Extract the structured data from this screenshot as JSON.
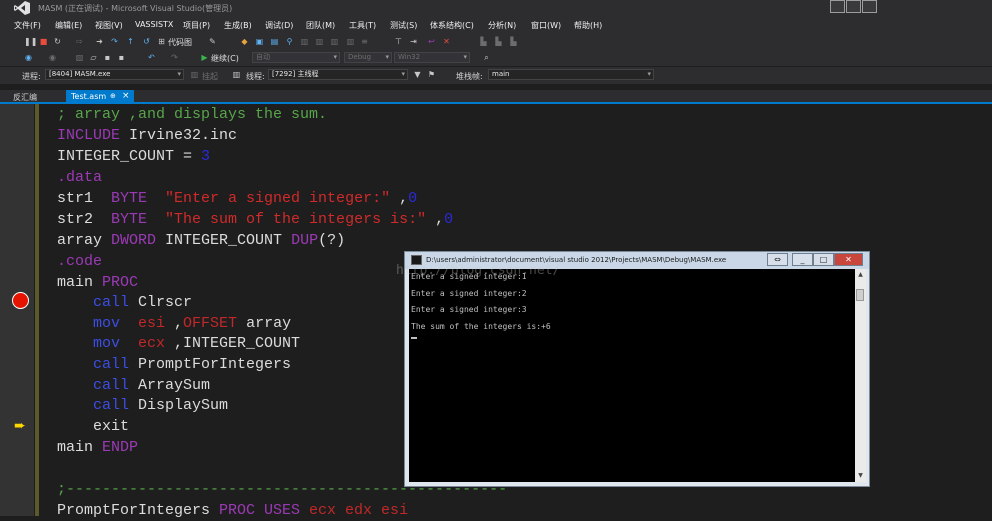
{
  "window": {
    "title": "MASM (正在调试) - Microsoft Visual Studio(管理员)"
  },
  "menu": [
    "文件(F)",
    "编辑(E)",
    "视图(V)",
    "VASSISTX",
    "项目(P)",
    "生成(B)",
    "调试(D)",
    "团队(M)",
    "工具(T)",
    "测试(S)",
    "体系结构(C)",
    "分析(N)",
    "窗口(W)",
    "帮助(H)"
  ],
  "toolbar": {
    "code_map_label": "代码图",
    "continue_label": "继续(C)",
    "auto_label": "自动",
    "config_value": "Debug",
    "platform_value": "Win32"
  },
  "debugbar": {
    "process_label": "进程:",
    "process_value": "[8404] MASM.exe",
    "suspend_label": "挂起",
    "thread_label": "线程:",
    "thread_value": "[7292] 主线程",
    "stack_label": "堆栈帧:",
    "stack_value": "main"
  },
  "tabs": {
    "disasm_label": "反汇编",
    "active_label": "Test.asm"
  },
  "code": {
    "l1": "; array ,and displays the sum.",
    "l2a": "INCLUDE",
    "l2b": " Irvine32.inc",
    "l3a": "INTEGER_COUNT = ",
    "l3b": "3",
    "l4": ".data",
    "l5a": "str1  ",
    "l5b": "BYTE",
    "l5c": "  \"Enter a signed integer:\"",
    "l5d": " ,",
    "l5e": "0",
    "l6a": "str2  ",
    "l6b": "BYTE",
    "l6c": "  \"The sum of the integers is:\"",
    "l6d": " ,",
    "l6e": "0",
    "l7a": "array ",
    "l7b": "DWORD",
    "l7c": " INTEGER_COUNT ",
    "l7d": "DUP",
    "l7e": "(?)",
    "l8": ".code",
    "l9a": "main ",
    "l9b": "PROC",
    "l10a": "    call",
    "l10b": " Clrscr",
    "l11a": "    mov",
    "l11b": "  esi",
    "l11c": " ,",
    "l11d": "OFFSET",
    "l11e": " array",
    "l12a": "    mov",
    "l12b": "  ecx",
    "l12c": " ,INTEGER_COUNT",
    "l13a": "    call",
    "l13b": " PromptForIntegers",
    "l14a": "    call",
    "l14b": " ArraySum",
    "l15a": "    call",
    "l15b": " DisplaySum",
    "l16": "    exit",
    "l17a": "main ",
    "l17b": "ENDP",
    "l19": ";-------------------------------------------------",
    "l20a": "PromptForIntegers ",
    "l20b": "PROC USES",
    "l20c": " ecx edx esi"
  },
  "console": {
    "title": "D:\\users\\administrator\\document\\visual studio 2012\\Projects\\MASM\\Debug\\MASM.exe",
    "lines": [
      "Enter a signed integer:1",
      "Enter a signed integer:2",
      "Enter a signed integer:3",
      "The sum of the integers is:+6"
    ]
  },
  "watermark": "http://blog.csdn.net/",
  "colors": {
    "accent": "#007acc",
    "breakpoint": "#e51400",
    "current_line_arrow": "#ffd700"
  }
}
